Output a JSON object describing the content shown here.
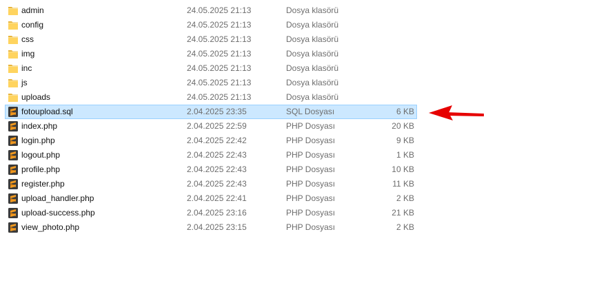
{
  "colors": {
    "selection_bg": "#cce8ff",
    "selection_border": "#99d1ff",
    "folder_fill": "#ffd45f",
    "sublime_orange": "#f29a1f",
    "sublime_bg": "#3b3b3b",
    "arrow": "#e60000"
  },
  "icons": {
    "folder": "folder-icon",
    "sublime": "sublime-text-file-icon",
    "arrow": "red-arrow-annotation"
  },
  "files": [
    {
      "name": "admin",
      "date": "24.05.2025 21:13",
      "type": "Dosya klasörü",
      "size": "",
      "icon": "folder",
      "selected": false
    },
    {
      "name": "config",
      "date": "24.05.2025 21:13",
      "type": "Dosya klasörü",
      "size": "",
      "icon": "folder",
      "selected": false
    },
    {
      "name": "css",
      "date": "24.05.2025 21:13",
      "type": "Dosya klasörü",
      "size": "",
      "icon": "folder",
      "selected": false
    },
    {
      "name": "img",
      "date": "24.05.2025 21:13",
      "type": "Dosya klasörü",
      "size": "",
      "icon": "folder",
      "selected": false
    },
    {
      "name": "inc",
      "date": "24.05.2025 21:13",
      "type": "Dosya klasörü",
      "size": "",
      "icon": "folder",
      "selected": false
    },
    {
      "name": "js",
      "date": "24.05.2025 21:13",
      "type": "Dosya klasörü",
      "size": "",
      "icon": "folder",
      "selected": false
    },
    {
      "name": "uploads",
      "date": "24.05.2025 21:13",
      "type": "Dosya klasörü",
      "size": "",
      "icon": "folder",
      "selected": false
    },
    {
      "name": "fotoupload.sql",
      "date": "2.04.2025 23:35",
      "type": "SQL Dosyası",
      "size": "6 KB",
      "icon": "sublime",
      "selected": true
    },
    {
      "name": "index.php",
      "date": "2.04.2025 22:59",
      "type": "PHP Dosyası",
      "size": "20 KB",
      "icon": "sublime",
      "selected": false
    },
    {
      "name": "login.php",
      "date": "2.04.2025 22:42",
      "type": "PHP Dosyası",
      "size": "9 KB",
      "icon": "sublime",
      "selected": false
    },
    {
      "name": "logout.php",
      "date": "2.04.2025 22:43",
      "type": "PHP Dosyası",
      "size": "1 KB",
      "icon": "sublime",
      "selected": false
    },
    {
      "name": "profile.php",
      "date": "2.04.2025 22:43",
      "type": "PHP Dosyası",
      "size": "10 KB",
      "icon": "sublime",
      "selected": false
    },
    {
      "name": "register.php",
      "date": "2.04.2025 22:43",
      "type": "PHP Dosyası",
      "size": "11 KB",
      "icon": "sublime",
      "selected": false
    },
    {
      "name": "upload_handler.php",
      "date": "2.04.2025 22:41",
      "type": "PHP Dosyası",
      "size": "2 KB",
      "icon": "sublime",
      "selected": false
    },
    {
      "name": "upload-success.php",
      "date": "2.04.2025 23:16",
      "type": "PHP Dosyası",
      "size": "21 KB",
      "icon": "sublime",
      "selected": false
    },
    {
      "name": "view_photo.php",
      "date": "2.04.2025 23:15",
      "type": "PHP Dosyası",
      "size": "2 KB",
      "icon": "sublime",
      "selected": false
    }
  ]
}
